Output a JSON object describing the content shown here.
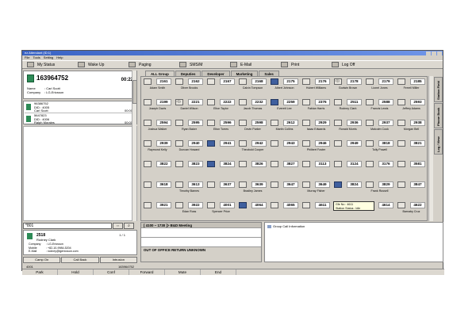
{
  "window": {
    "title": "ez Attendant (ID:1)"
  },
  "menu": [
    "File",
    "Tools",
    "Setting",
    "Help"
  ],
  "toolbar": [
    {
      "label": "My Status",
      "icon": "status-icon"
    },
    {
      "label": "Wake Up",
      "icon": "wakeup-icon"
    },
    {
      "label": "Paging",
      "icon": "paging-icon"
    },
    {
      "label": "SMS/M",
      "icon": "sms-icon"
    },
    {
      "label": "E-Mail",
      "icon": "email-icon"
    },
    {
      "label": "Print",
      "icon": "printer-icon"
    },
    {
      "label": "Log Off",
      "icon": "logoff-icon"
    }
  ],
  "active_call": {
    "number": "163964752",
    "timer": "00:22",
    "name_label": "Name",
    "name": ": Carl Scott",
    "company_label": "Company",
    "company": ": LG-Ericsson"
  },
  "queue": [
    {
      "line1": "96386752",
      "line2": "DID : 4005",
      "line3": "Carl Scott",
      "time": "00:00"
    },
    {
      "line1": "5647823",
      "line2": "DID : 4006",
      "line3": "Ralph Morales",
      "time": "00:00"
    }
  ],
  "search": {
    "value": "*801",
    "btn1": "⇔",
    "btn2": "⌕"
  },
  "contact": {
    "ext": "2518",
    "page": "1 / 1",
    "name": "Rodney Clark",
    "rows": [
      {
        "k": "Company",
        "v": ": LG-Ericsson"
      },
      {
        "k": "Mobile",
        "v": ": +82-10-9984-5204"
      },
      {
        "k": "E-Mail",
        "v": ": rodney@lgericsson.com"
      }
    ]
  },
  "left_buttons": [
    "Camp On",
    "Call Back",
    "Intrusion"
  ],
  "tabs": [
    "ALL Group",
    "Deputies",
    "Developer",
    "Marketing",
    "Sales"
  ],
  "grid": [
    [
      {
        "ext": "2161",
        "name": "Adam Smith",
        "st": "idle"
      },
      {
        "ext": "2162",
        "name": "Oliver Brooks",
        "st": "idle"
      },
      {
        "ext": "2167",
        "name": "",
        "st": "idle"
      },
      {
        "ext": "2168",
        "name": "Calvin Tompson",
        "st": "idle"
      },
      {
        "ext": "2175",
        "name": "Albert Johnson",
        "st": "busy"
      },
      {
        "ext": "2176",
        "name": "Hubert Williams",
        "st": "idle"
      },
      {
        "ext": "2178",
        "name": "Godwin Brown",
        "st": "ring"
      },
      {
        "ext": "2179",
        "name": "Lionel Jones",
        "st": "idle"
      },
      {
        "ext": "2185",
        "name": "Ferrell Miller",
        "st": "idle"
      }
    ],
    [
      {
        "ext": "2199",
        "name": "Joseph Davis",
        "st": "idle"
      },
      {
        "ext": "2221",
        "name": "Daniel Wilson",
        "st": "ring"
      },
      {
        "ext": "2222",
        "name": "Elton Taylor",
        "st": "idle"
      },
      {
        "ext": "2232",
        "name": "Jacob Thomas",
        "st": "idle"
      },
      {
        "ext": "2259",
        "name": "Everett Lee",
        "st": "busy"
      },
      {
        "ext": "2376",
        "name": "Fabian Harris",
        "st": "idle"
      },
      {
        "ext": "2511",
        "name": "Rodney Clark",
        "st": "idle"
      },
      {
        "ext": "2588",
        "name": "Francis Lewis",
        "st": "idle"
      },
      {
        "ext": "2593",
        "name": "Jeffrey Adams",
        "st": "idle"
      }
    ],
    [
      {
        "ext": "2594",
        "name": "Joshua Walker",
        "st": "idle"
      },
      {
        "ext": "2595",
        "name": "Ryan Baker",
        "st": "idle"
      },
      {
        "ext": "2596",
        "name": "Elton Torres",
        "st": "idle"
      },
      {
        "ext": "2598",
        "name": "Devin Parker",
        "st": "idle"
      },
      {
        "ext": "2612",
        "name": "Martin Collins",
        "st": "idle"
      },
      {
        "ext": "2929",
        "name": "Isaac Edwards",
        "st": "idle"
      },
      {
        "ext": "2936",
        "name": "Ronald Morris",
        "st": "idle"
      },
      {
        "ext": "2937",
        "name": "Malcolm Cook",
        "st": "idle"
      },
      {
        "ext": "2938",
        "name": "Morgan Bell",
        "st": "idle"
      }
    ],
    [
      {
        "ext": "2939",
        "name": "Raymond Kelly",
        "st": "idle"
      },
      {
        "ext": "2940",
        "name": "Duncan Howard",
        "st": "idle"
      },
      {
        "ext": "2941",
        "name": "",
        "st": "busy"
      },
      {
        "ext": "2942",
        "name": "Theobold Cooper",
        "st": "idle"
      },
      {
        "ext": "2943",
        "name": "",
        "st": "idle"
      },
      {
        "ext": "2946",
        "name": "Philbert Foster",
        "st": "idle"
      },
      {
        "ext": "2949",
        "name": "",
        "st": "idle"
      },
      {
        "ext": "3818",
        "name": "Tolly Powell",
        "st": "idle"
      },
      {
        "ext": "3821",
        "name": "",
        "st": "idle"
      }
    ],
    [
      {
        "ext": "3822",
        "name": "",
        "st": "idle"
      },
      {
        "ext": "3823",
        "name": "",
        "st": "idle"
      },
      {
        "ext": "3824",
        "name": "",
        "st": "busy"
      },
      {
        "ext": "3826",
        "name": "",
        "st": "idle"
      },
      {
        "ext": "3827",
        "name": "",
        "st": "idle"
      },
      {
        "ext": "3113",
        "name": "",
        "st": "idle"
      },
      {
        "ext": "3124",
        "name": "",
        "st": "idle"
      },
      {
        "ext": "3176",
        "name": "",
        "st": "idle"
      },
      {
        "ext": "3581",
        "name": "",
        "st": "idle"
      }
    ],
    [
      {
        "ext": "3618",
        "name": "",
        "st": "idle"
      },
      {
        "ext": "3613",
        "name": "Timothy Barnes",
        "st": "idle"
      },
      {
        "ext": "3637",
        "name": "",
        "st": "idle"
      },
      {
        "ext": "3639",
        "name": "Bradley James",
        "st": "idle"
      },
      {
        "ext": "3647",
        "name": "",
        "st": "idle"
      },
      {
        "ext": "3649",
        "name": "Murray Fisher",
        "st": "idle"
      },
      {
        "ext": "3824",
        "name": "",
        "st": "busy"
      },
      {
        "ext": "3829",
        "name": "Frank Russell",
        "st": "idle"
      },
      {
        "ext": "3847",
        "name": "",
        "st": "idle"
      }
    ],
    [
      {
        "ext": "3921",
        "name": "",
        "st": "idle"
      },
      {
        "ext": "3922",
        "name": "Edan Ross",
        "st": "idle"
      },
      {
        "ext": "4001",
        "name": "Spencer Price",
        "st": "idle"
      },
      {
        "ext": "4064",
        "name": "",
        "st": "busy"
      },
      {
        "ext": "4065",
        "name": "",
        "st": "idle"
      },
      {
        "ext": "4611",
        "name": "",
        "st": "idle"
      },
      {
        "ext": "4613",
        "name": "",
        "st": "busy"
      },
      {
        "ext": "4614",
        "name": "",
        "st": "idle"
      },
      {
        "ext": "4622",
        "name": "Barnaby Cruz",
        "st": "idle"
      }
    ]
  ],
  "tooltip": {
    "line1": "Gfe No : 4611",
    "line2": "Station Status : Idle"
  },
  "side_tabs": [
    "Station Field",
    "Phone Book",
    "Log / View"
  ],
  "notice": {
    "line1": "[ 4100 ~ 1730 ]> B&D Meeting",
    "line2": "OUT OF OFFICE   RETURN UNKNOWN"
  },
  "group_info": {
    "label": "Group Call Information"
  },
  "status_line": {
    "left": "4001",
    "right": "163964752"
  },
  "bottom_bar": [
    "Park",
    "Hold",
    "Conf",
    "Forward",
    "Mute",
    "End"
  ]
}
